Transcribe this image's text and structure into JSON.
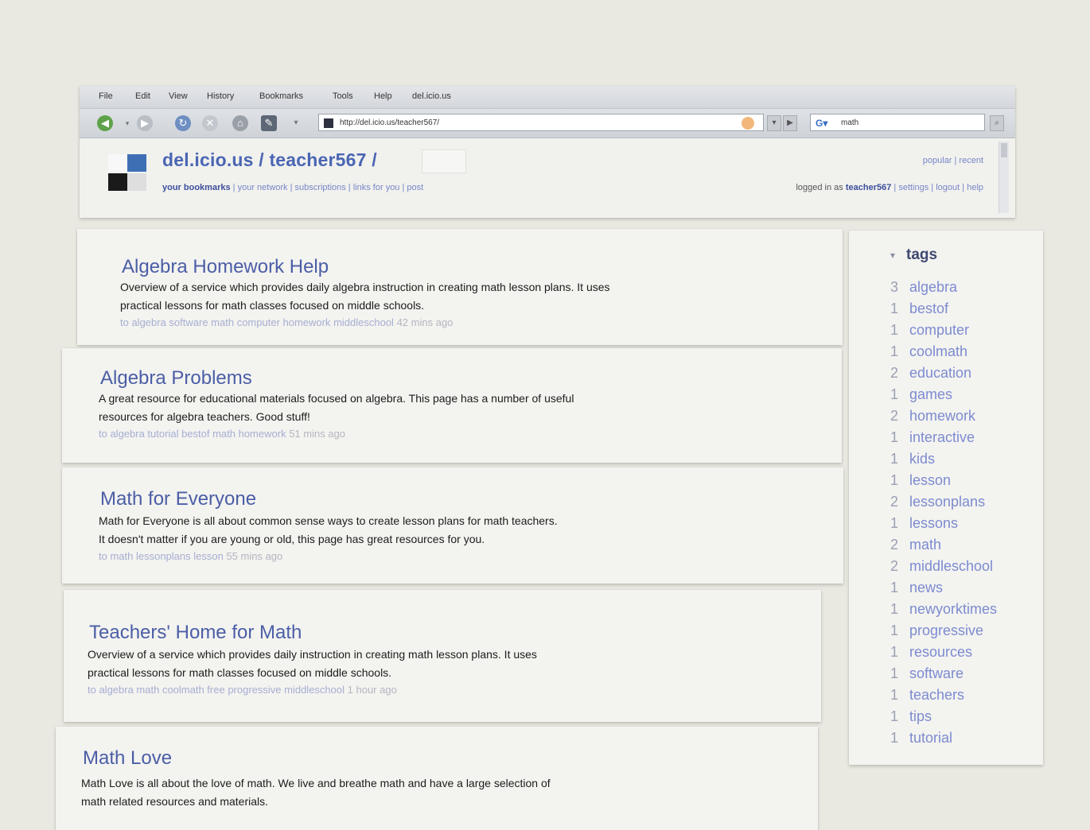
{
  "browser": {
    "menu": [
      "File",
      "Edit",
      "View",
      "History",
      "Bookmarks",
      "Tools",
      "Help",
      "del.icio.us"
    ],
    "url": "http://del.icio.us/teacher567/",
    "search_value": "math"
  },
  "header": {
    "site_title": "del.icio.us / teacher567 /",
    "nav_links": [
      "your bookmarks",
      "your network",
      "subscriptions",
      "links for you",
      "post"
    ],
    "top_right_links": [
      "popular",
      "recent"
    ],
    "logged_in_prefix": "logged in as",
    "username": "teacher567",
    "account_links": [
      "settings",
      "logout",
      "help"
    ]
  },
  "bookmarks": [
    {
      "title": "Algebra Homework Help",
      "description_lines": [
        "Overview of a service which provides daily algebra instruction in creating math lesson plans. It uses",
        "practical lessons for math classes focused on middle schools."
      ],
      "tags_line": "to algebra software math computer homework middleschool",
      "time": "42 mins ago"
    },
    {
      "title": "Algebra Problems",
      "description_lines": [
        "A great resource for educational materials focused on algebra.  This page has a number of useful",
        "resources for algebra teachers.  Good stuff!"
      ],
      "tags_line": "to algebra tutorial bestof math homework",
      "time": "51 mins ago"
    },
    {
      "title": "Math for Everyone",
      "description_lines": [
        "Math for Everyone is all about common sense ways to create lesson plans for math teachers.",
        " It doesn't matter if you are young or old, this page has great resources for you."
      ],
      "tags_line": "to math lessonplans lesson",
      "time": "55 mins ago"
    },
    {
      "title": "Teachers' Home for Math",
      "description_lines": [
        "Overview of a service which provides daily instruction in creating math lesson plans. It uses",
        "practical lessons for math classes focused on middle schools."
      ],
      "tags_line": "to algebra math coolmath free progressive middleschool",
      "time": "1 hour ago"
    },
    {
      "title": "Math Love",
      "description_lines": [
        "Math Love is all about the love of math.  We live and breathe math and have a large selection of",
        "math related resources and materials."
      ],
      "tags_line": "",
      "time": ""
    }
  ],
  "tags_panel": {
    "title": "tags",
    "items": [
      {
        "count": "3",
        "name": "algebra"
      },
      {
        "count": "1",
        "name": "bestof"
      },
      {
        "count": "1",
        "name": "computer"
      },
      {
        "count": "1",
        "name": "coolmath"
      },
      {
        "count": "2",
        "name": "education"
      },
      {
        "count": "1",
        "name": "games"
      },
      {
        "count": "2",
        "name": "homework"
      },
      {
        "count": "1",
        "name": "interactive"
      },
      {
        "count": "1",
        "name": "kids"
      },
      {
        "count": "1",
        "name": "lesson"
      },
      {
        "count": "2",
        "name": "lessonplans"
      },
      {
        "count": "1",
        "name": "lessons"
      },
      {
        "count": "2",
        "name": "math"
      },
      {
        "count": "2",
        "name": "middleschool"
      },
      {
        "count": "1",
        "name": "news"
      },
      {
        "count": "1",
        "name": "newyorktimes"
      },
      {
        "count": "1",
        "name": "progressive"
      },
      {
        "count": "1",
        "name": "resources"
      },
      {
        "count": "1",
        "name": "software"
      },
      {
        "count": "1",
        "name": "teachers"
      },
      {
        "count": "1",
        "name": "tips"
      },
      {
        "count": "1",
        "name": "tutorial"
      }
    ]
  },
  "colors": {
    "link_blue": "#4b5ea6",
    "tag_blue": "#7d8bd0",
    "meta_gray": "#a7aed1",
    "paper": "#f3f3f0",
    "wall": "#e9e9e1"
  }
}
